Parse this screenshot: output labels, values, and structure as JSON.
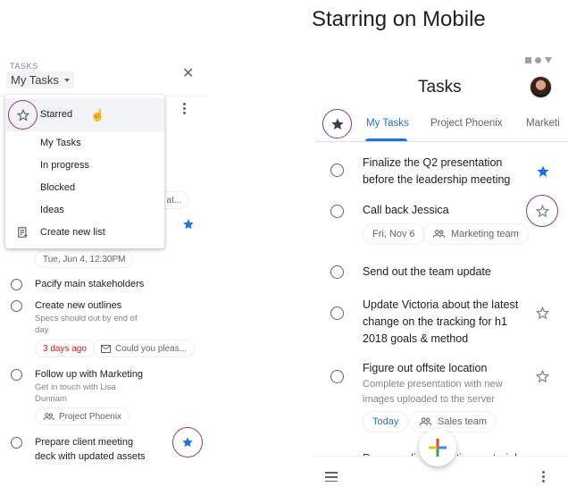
{
  "left_panel": {
    "section_label": "TASKS",
    "current_list": "My Tasks",
    "dropdown": {
      "items": [
        {
          "label": "Starred",
          "icon": "star-outline-icon",
          "highlighted": true
        },
        {
          "label": "My Tasks"
        },
        {
          "label": "In progress"
        },
        {
          "label": "Blocked"
        },
        {
          "label": "Ideas"
        },
        {
          "label": "Create new list",
          "icon": "playlist-add-icon"
        }
      ]
    },
    "background_chip_partial": "t at...",
    "tasks": [
      {
        "title": "",
        "chips": [
          {
            "text": "Tue, Jun 4, 12:30PM"
          }
        ],
        "starred": true
      },
      {
        "title": "Pacify main stakeholders"
      },
      {
        "title": "Create new outlines",
        "note": [
          "Specs should out by end of",
          "day"
        ],
        "chips": [
          {
            "text": "3 days ago",
            "color": "#c5221f"
          },
          {
            "text": "Could you pleas...",
            "icon": "mail-icon"
          }
        ]
      },
      {
        "title": "Follow up with Marketing",
        "note": [
          "Get in touch with Lisa",
          "Dunnam"
        ],
        "chips": [
          {
            "text": "Project Phoenix",
            "icon": "group-icon"
          }
        ]
      },
      {
        "title": [
          "Prepare client meeting",
          "deck with updated assets"
        ],
        "starred": true
      }
    ]
  },
  "right_panel": {
    "heading": "Starring on Mobile",
    "app_title": "Tasks",
    "tabs": [
      {
        "label": "My Tasks",
        "active": true
      },
      {
        "label": "Project Phoenix"
      },
      {
        "label": "Marketi"
      }
    ],
    "tasks": [
      {
        "title": [
          "Finalize the Q2 presentation",
          "before the leadership meeting"
        ],
        "starred": true
      },
      {
        "title": "Call back Jessica",
        "starred": false,
        "chips": [
          {
            "text": "Fri, Nov 6"
          },
          {
            "text": "Marketing team",
            "icon": "group-icon"
          }
        ]
      },
      {
        "title": "Send out the team update"
      },
      {
        "title": [
          "Update Victoria about the latest",
          "change on the tracking for h1",
          "2018 goals & method"
        ],
        "starred": false
      },
      {
        "title": "Figure out offsite location",
        "starred": false,
        "note": [
          "Complete presentation with new",
          "images uploaded to the server"
        ],
        "chips": [
          {
            "text": "Today",
            "color": "#1a73e8"
          },
          {
            "text": "Sales team",
            "icon": "group-icon"
          }
        ]
      },
      {
        "title": "Prepare client meeting material"
      }
    ]
  },
  "colors": {
    "accent_blue": "#1a73e8",
    "star_blue": "#1a73e8",
    "highlight_ring": "#8e3a80",
    "overdue_red": "#c5221f"
  }
}
